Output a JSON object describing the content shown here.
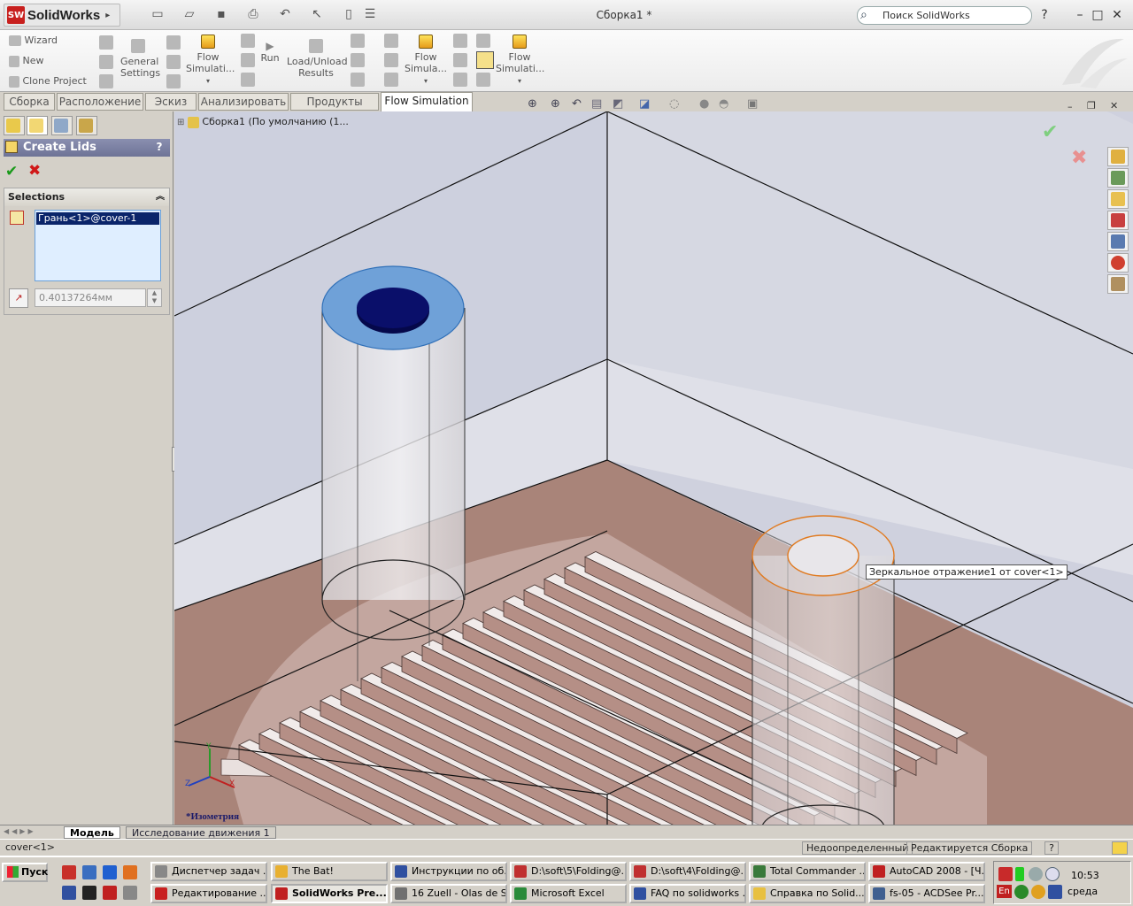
{
  "app": {
    "brand": "SolidWorks",
    "logo_mark": "SW",
    "doc_title": "Сборка1 *",
    "search_placeholder": "Поиск SolidWorks"
  },
  "ribbon": {
    "wizard": "Wizard",
    "new": "New",
    "clone_project": "Clone Project",
    "general_settings_1": "General",
    "general_settings_2": "Settings",
    "flow_sim_1a": "Flow",
    "flow_sim_1b": "Simulati...",
    "run": "Run",
    "load_unload_1": "Load/Unload",
    "load_unload_2": "Results",
    "flow_sim_2a": "Flow",
    "flow_sim_2b": "Simula...",
    "flow_sim_3a": "Flow",
    "flow_sim_3b": "Simulati..."
  },
  "tabs": [
    "Сборка",
    "Расположение",
    "Эскиз",
    "Анализировать",
    "Продукты Office",
    "Flow Simulation"
  ],
  "panel": {
    "title": "Create Lids",
    "help": "?",
    "section": "Selections",
    "selected_face": "Грань<1>@cover-1",
    "thickness": "0.40137264мм"
  },
  "tree": {
    "root": "Сборка1  (По умолчанию (1..."
  },
  "viewport": {
    "tooltip": "Зеркальное отражение1 от cover<1>",
    "view_name": "*Изометрия",
    "triad_x": "X",
    "triad_y": "Y",
    "triad_z": "Z"
  },
  "bottom_tabs": [
    "Модель",
    "Исследование движения 1"
  ],
  "status": {
    "left": "cover<1>",
    "state": "Недоопределенный",
    "mode": "Редактируется Сборка",
    "help": "?"
  },
  "taskbar": {
    "start": "Пуск",
    "row1": [
      "Диспетчер задач ...",
      "The Bat!",
      "Инструкции по об...",
      "D:\\soft\\5\\Folding@...",
      "D:\\soft\\4\\Folding@...",
      "Total Commander ...",
      "AutoCAD 2008 - [Ч..."
    ],
    "row2": [
      "Редактирование ...",
      "SolidWorks Pre...",
      "16 Zuell - Olas de S...",
      "Microsoft Excel",
      "FAQ по solidworks ...",
      "Справка по Solid...",
      "fs-05 - ACDSee Pr..."
    ],
    "time": "10:53",
    "day": "среда",
    "lang": "En"
  },
  "colors": {
    "viewport_bg": "#cfd1de",
    "floor": "#a98479",
    "selected_face": "#6fa1d8",
    "highlight": "#e07a20",
    "panel_header": "#7a7fa2"
  }
}
